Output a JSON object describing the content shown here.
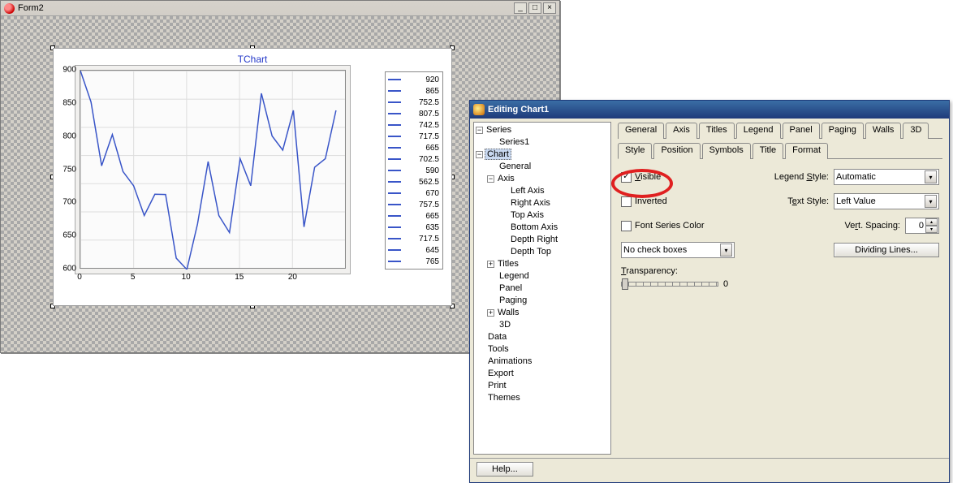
{
  "form2": {
    "title": "Form2"
  },
  "chart": {
    "title": "TChart",
    "legend": [
      "920",
      "865",
      "752.5",
      "807.5",
      "742.5",
      "717.5",
      "665",
      "702.5",
      "590",
      "562.5",
      "670",
      "757.5",
      "665",
      "635",
      "717.5",
      "645",
      "765"
    ],
    "y_ticks": [
      "900",
      "850",
      "800",
      "750",
      "700",
      "650",
      "600"
    ],
    "x_ticks": [
      "0",
      "5",
      "10",
      "15",
      "20"
    ]
  },
  "chart_data": {
    "type": "line",
    "title": "TChart",
    "xlabel": "",
    "ylabel": "",
    "xlim": [
      0,
      25
    ],
    "ylim": [
      570,
      920
    ],
    "x": [
      0,
      1,
      2,
      3,
      4,
      5,
      6,
      7,
      8,
      9,
      10,
      11,
      12,
      13,
      14,
      15,
      16,
      17,
      18,
      19,
      20,
      21,
      22,
      23,
      24
    ],
    "values": [
      920,
      865,
      752.5,
      807.5,
      742.5,
      717.5,
      665,
      702.5,
      702,
      590,
      570,
      650,
      760,
      665,
      635,
      765,
      717.5,
      880,
      805,
      780,
      850,
      645,
      750,
      765,
      850
    ]
  },
  "dialog": {
    "title": "Editing Chart1",
    "tree": {
      "series": "Series",
      "series1": "Series1",
      "chart": "Chart",
      "general": "General",
      "axis": "Axis",
      "left_axis": "Left Axis",
      "right_axis": "Right Axis",
      "top_axis": "Top Axis",
      "bottom_axis": "Bottom Axis",
      "depth_right": "Depth Right",
      "depth_top": "Depth Top",
      "titles": "Titles",
      "legend": "Legend",
      "panel": "Panel",
      "paging": "Paging",
      "walls": "Walls",
      "threeD": "3D",
      "data": "Data",
      "tools": "Tools",
      "animations": "Animations",
      "export": "Export",
      "print": "Print",
      "themes": "Themes"
    },
    "tabs": {
      "general": "General",
      "axis": "Axis",
      "titles": "Titles",
      "legend": "Legend",
      "panel": "Panel",
      "paging": "Paging",
      "walls": "Walls",
      "threeD": "3D"
    },
    "subtabs": {
      "style": "Style",
      "position": "Position",
      "symbols": "Symbols",
      "title": "Title",
      "format": "Format"
    },
    "fields": {
      "visible": "Visible",
      "inverted": "Inverted",
      "font_series_color": "Font Series Color",
      "legend_style": "Legend Style:",
      "legend_style_val": "Automatic",
      "text_style": "Text Style:",
      "text_style_val": "Left Value",
      "vert_spacing": "Vert. Spacing:",
      "vert_spacing_val": "0",
      "checkboxes_combo": "No check boxes",
      "dividing_lines": "Dividing Lines...",
      "transparency": "Transparency:",
      "transparency_val": "0",
      "help": "Help..."
    }
  }
}
